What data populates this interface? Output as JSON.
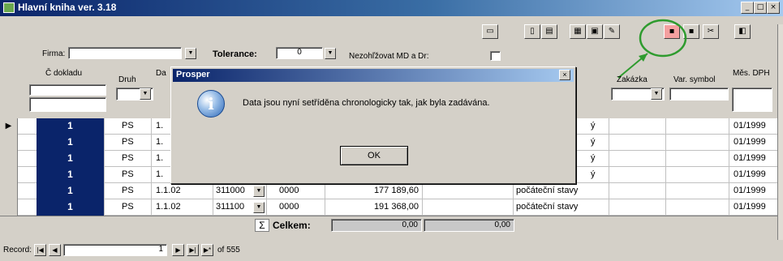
{
  "window": {
    "title": "Hlavní kniha ver. 3.18",
    "controls": [
      "_",
      "□",
      "×"
    ]
  },
  "filters": {
    "firma_label": "Firma:",
    "tolerance_label": "Tolerance:",
    "tolerance_value": "0",
    "nezohl_label": "Nezohľžovat MD a Dr:"
  },
  "columns": {
    "cislo_dokladu": "Č dokladu",
    "druh": "Druh",
    "datum_partial": "Da",
    "zakazka": "Zakázka",
    "var_symbol": "Var. symbol",
    "mes_dph": "Měs. DPH"
  },
  "rows": [
    {
      "doc": "1",
      "druh": "PS",
      "datum": "1.",
      "ucet": "",
      "stredisko": "",
      "castka": "",
      "popis": "ý",
      "mes": "01/1999"
    },
    {
      "doc": "1",
      "druh": "PS",
      "datum": "1.",
      "ucet": "",
      "stredisko": "",
      "castka": "",
      "popis": "ý",
      "mes": "01/1999"
    },
    {
      "doc": "1",
      "druh": "PS",
      "datum": "1.",
      "ucet": "",
      "stredisko": "",
      "castka": "",
      "popis": "ý",
      "mes": "01/1999"
    },
    {
      "doc": "1",
      "druh": "PS",
      "datum": "1.",
      "ucet": "",
      "stredisko": "",
      "castka": "",
      "popis": "ý",
      "mes": "01/1999"
    },
    {
      "doc": "1",
      "druh": "PS",
      "datum": "1.1.02",
      "ucet": "311000",
      "stredisko": "0000",
      "castka": "177 189,60",
      "popis": "počáteční stavy",
      "mes": "01/1999"
    },
    {
      "doc": "1",
      "druh": "PS",
      "datum": "1.1.02",
      "ucet": "311100",
      "stredisko": "0000",
      "castka": "191 368,00",
      "popis": "počáteční stavy",
      "mes": "01/1999"
    }
  ],
  "totals": {
    "sigma": "Σ",
    "label": "Celkem:",
    "md": "0,00",
    "dal": "0,00"
  },
  "dialog": {
    "title": "Prosper",
    "close": "×",
    "message": "Data jsou nyní setříděna chronologicky tak, jak byla zadávána.",
    "ok_label": "OK",
    "icon": "info-icon"
  },
  "records": {
    "label": "Record:",
    "current": "1",
    "of_label": "of 555"
  },
  "toolbar_icons": [
    "print-icon",
    "copy-icon",
    "book-icon",
    "calc-icon",
    "grid-icon",
    "edit-icon",
    "highlight-icon",
    "save-icon",
    "cut-icon",
    "exit-icon"
  ],
  "colors": {
    "selection": "#0a246a",
    "highlight_circle": "#2e9b2e",
    "highlight_arrow": "#2e9b2e",
    "dialog_bg": "#d4d0c8"
  }
}
